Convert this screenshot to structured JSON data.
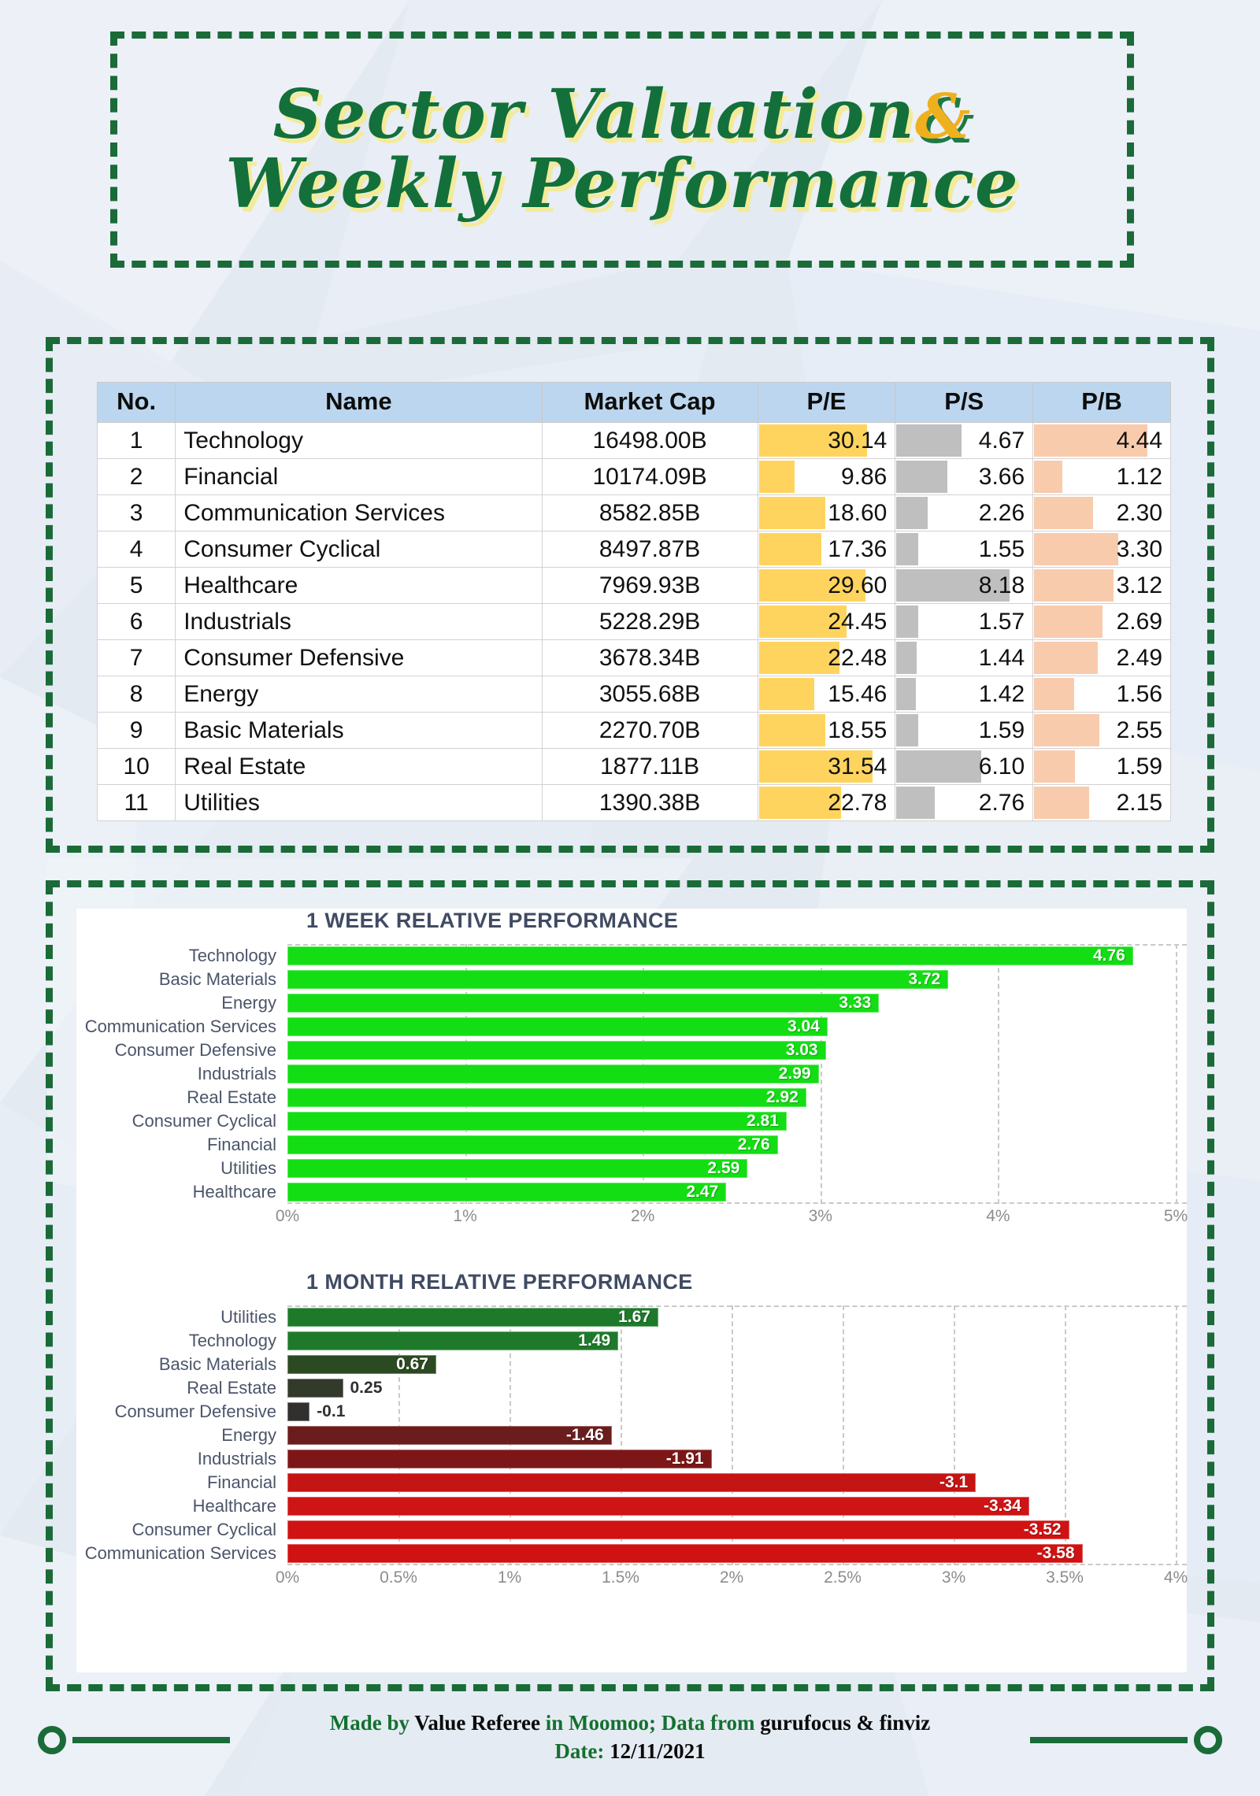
{
  "title": {
    "line1": "Sector Valuation",
    "amp": "&",
    "line2": "Weekly Performance"
  },
  "watermark": "Value Referee",
  "table": {
    "columns": [
      "No.",
      "Name",
      "Market Cap",
      "P/E",
      "P/S",
      "P/B"
    ],
    "rows": [
      {
        "no": "1",
        "name": "Technology",
        "mcap": "16498.00B",
        "pe": "30.14",
        "ps": "4.67",
        "pb": "4.44"
      },
      {
        "no": "2",
        "name": "Financial",
        "mcap": "10174.09B",
        "pe": "9.86",
        "ps": "3.66",
        "pb": "1.12"
      },
      {
        "no": "3",
        "name": "Communication Services",
        "mcap": "8582.85B",
        "pe": "18.60",
        "ps": "2.26",
        "pb": "2.30"
      },
      {
        "no": "4",
        "name": "Consumer Cyclical",
        "mcap": "8497.87B",
        "pe": "17.36",
        "ps": "1.55",
        "pb": "3.30"
      },
      {
        "no": "5",
        "name": "Healthcare",
        "mcap": "7969.93B",
        "pe": "29.60",
        "ps": "8.18",
        "pb": "3.12"
      },
      {
        "no": "6",
        "name": "Industrials",
        "mcap": "5228.29B",
        "pe": "24.45",
        "ps": "1.57",
        "pb": "2.69"
      },
      {
        "no": "7",
        "name": "Consumer Defensive",
        "mcap": "3678.34B",
        "pe": "22.48",
        "ps": "1.44",
        "pb": "2.49"
      },
      {
        "no": "8",
        "name": "Energy",
        "mcap": "3055.68B",
        "pe": "15.46",
        "ps": "1.42",
        "pb": "1.56"
      },
      {
        "no": "9",
        "name": "Basic Materials",
        "mcap": "2270.70B",
        "pe": "18.55",
        "ps": "1.59",
        "pb": "2.55"
      },
      {
        "no": "10",
        "name": "Real Estate",
        "mcap": "1877.11B",
        "pe": "31.54",
        "ps": "6.10",
        "pb": "1.59"
      },
      {
        "no": "11",
        "name": "Utilities",
        "mcap": "1390.38B",
        "pe": "22.78",
        "ps": "2.76",
        "pb": "2.15"
      }
    ],
    "bar_colors": {
      "pe": "#ffd45e",
      "ps": "#bfbfbf",
      "pb": "#f8cbad"
    },
    "header_bg": "#bcd6ef"
  },
  "chart_data": [
    {
      "type": "bar",
      "orientation": "horizontal",
      "title": "1 WEEK RELATIVE PERFORMANCE",
      "categories": [
        "Technology",
        "Basic Materials",
        "Energy",
        "Communication Services",
        "Consumer Defensive",
        "Industrials",
        "Real Estate",
        "Consumer Cyclical",
        "Financial",
        "Utilities",
        "Healthcare"
      ],
      "values": [
        4.76,
        3.72,
        3.33,
        3.04,
        3.03,
        2.99,
        2.92,
        2.81,
        2.76,
        2.59,
        2.47
      ],
      "xlabel": "",
      "ylabel": "",
      "xlim": [
        0,
        5
      ],
      "xticks": [
        "0%",
        "1%",
        "2%",
        "3%",
        "4%",
        "5%"
      ],
      "xtick_values": [
        0,
        1,
        2,
        3,
        4,
        5
      ],
      "grid": true,
      "legend": "none",
      "bar_color": "#13de13",
      "label_color": "#ffffff"
    },
    {
      "type": "bar",
      "orientation": "horizontal",
      "title": "1 MONTH RELATIVE PERFORMANCE",
      "categories": [
        "Utilities",
        "Technology",
        "Basic Materials",
        "Real Estate",
        "Consumer Defensive",
        "Energy",
        "Industrials",
        "Financial",
        "Healthcare",
        "Consumer Cyclical",
        "Communication Services"
      ],
      "values": [
        1.67,
        1.49,
        0.67,
        0.25,
        -0.1,
        -1.46,
        -1.91,
        -3.1,
        -3.34,
        -3.52,
        -3.58
      ],
      "bar_colors": [
        "#1e7a2a",
        "#1e7a2a",
        "#2c4a22",
        "#333a2c",
        "#32302e",
        "#6b1d1d",
        "#7d1717",
        "#c51414",
        "#ce1414",
        "#d01212",
        "#d01212"
      ],
      "label_inside": [
        true,
        true,
        true,
        false,
        false,
        true,
        true,
        true,
        true,
        true,
        true
      ],
      "xlabel": "",
      "ylabel": "",
      "xlim": [
        0,
        4
      ],
      "xticks": [
        "0%",
        "0.5%",
        "1%",
        "1.5%",
        "2%",
        "2.5%",
        "3%",
        "3.5%",
        "4%"
      ],
      "xtick_values": [
        0,
        0.5,
        1,
        1.5,
        2,
        2.5,
        3,
        3.5,
        4
      ],
      "grid": true,
      "legend": "none"
    }
  ],
  "footer": {
    "l1_a": "Made by ",
    "l1_b": "Value Referee",
    "l1_c": " in Moomoo; Data from ",
    "l1_d": "gurufocus & finviz",
    "l2_a": "Date: ",
    "l2_b": "12/11/2021"
  }
}
